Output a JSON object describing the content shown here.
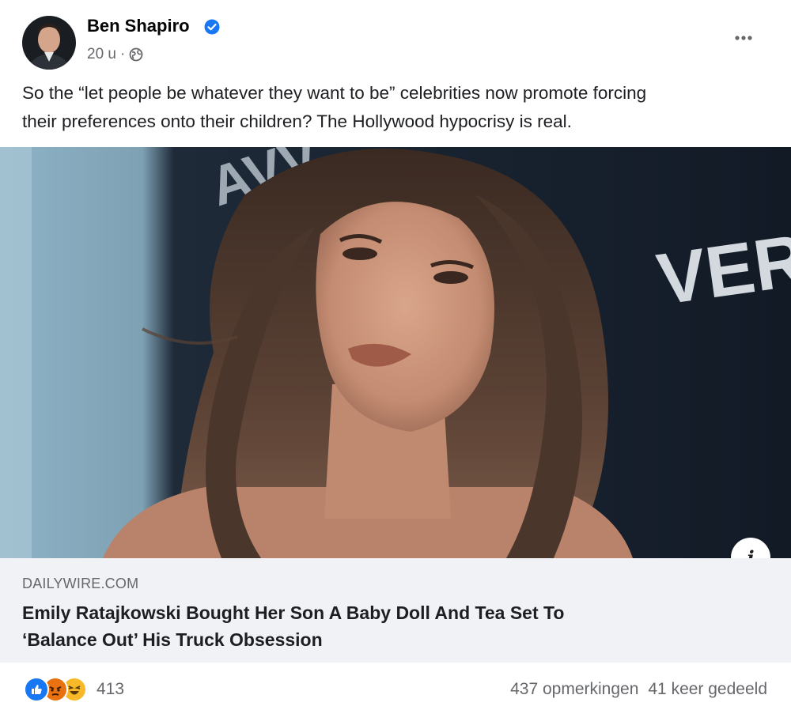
{
  "author": {
    "name": "Ben Shapiro",
    "verified": true,
    "time": "20 u",
    "separator": "·",
    "audience_icon": "globe-icon"
  },
  "post": {
    "text_line1": "So the “let people be whatever they want to be” celebrities now promote forcing",
    "text_line2": "their preferences onto their children? The Hollywood hypocrisy is real."
  },
  "media": {
    "backdrop_text_left": "AVV",
    "backdrop_text_right": "VER"
  },
  "link": {
    "domain": "DAILYWIRE.COM",
    "title_line1": "Emily Ratajkowski Bought Her Son A Baby Doll And Tea Set To",
    "title_line2": "‘Balance Out’ His Truck Obsession"
  },
  "engagement": {
    "reaction_icons": [
      "like-icon",
      "angry-icon",
      "haha-icon"
    ],
    "reaction_count": "413",
    "comments": "437 opmerkingen",
    "shares": "41 keer gedeeld"
  },
  "colors": {
    "verified": "#1877f2",
    "like": "#1877f2",
    "angry": "#e9710f",
    "haha": "#f7b928",
    "secondary_text": "#65676b",
    "link_bg": "#f0f2f5"
  }
}
